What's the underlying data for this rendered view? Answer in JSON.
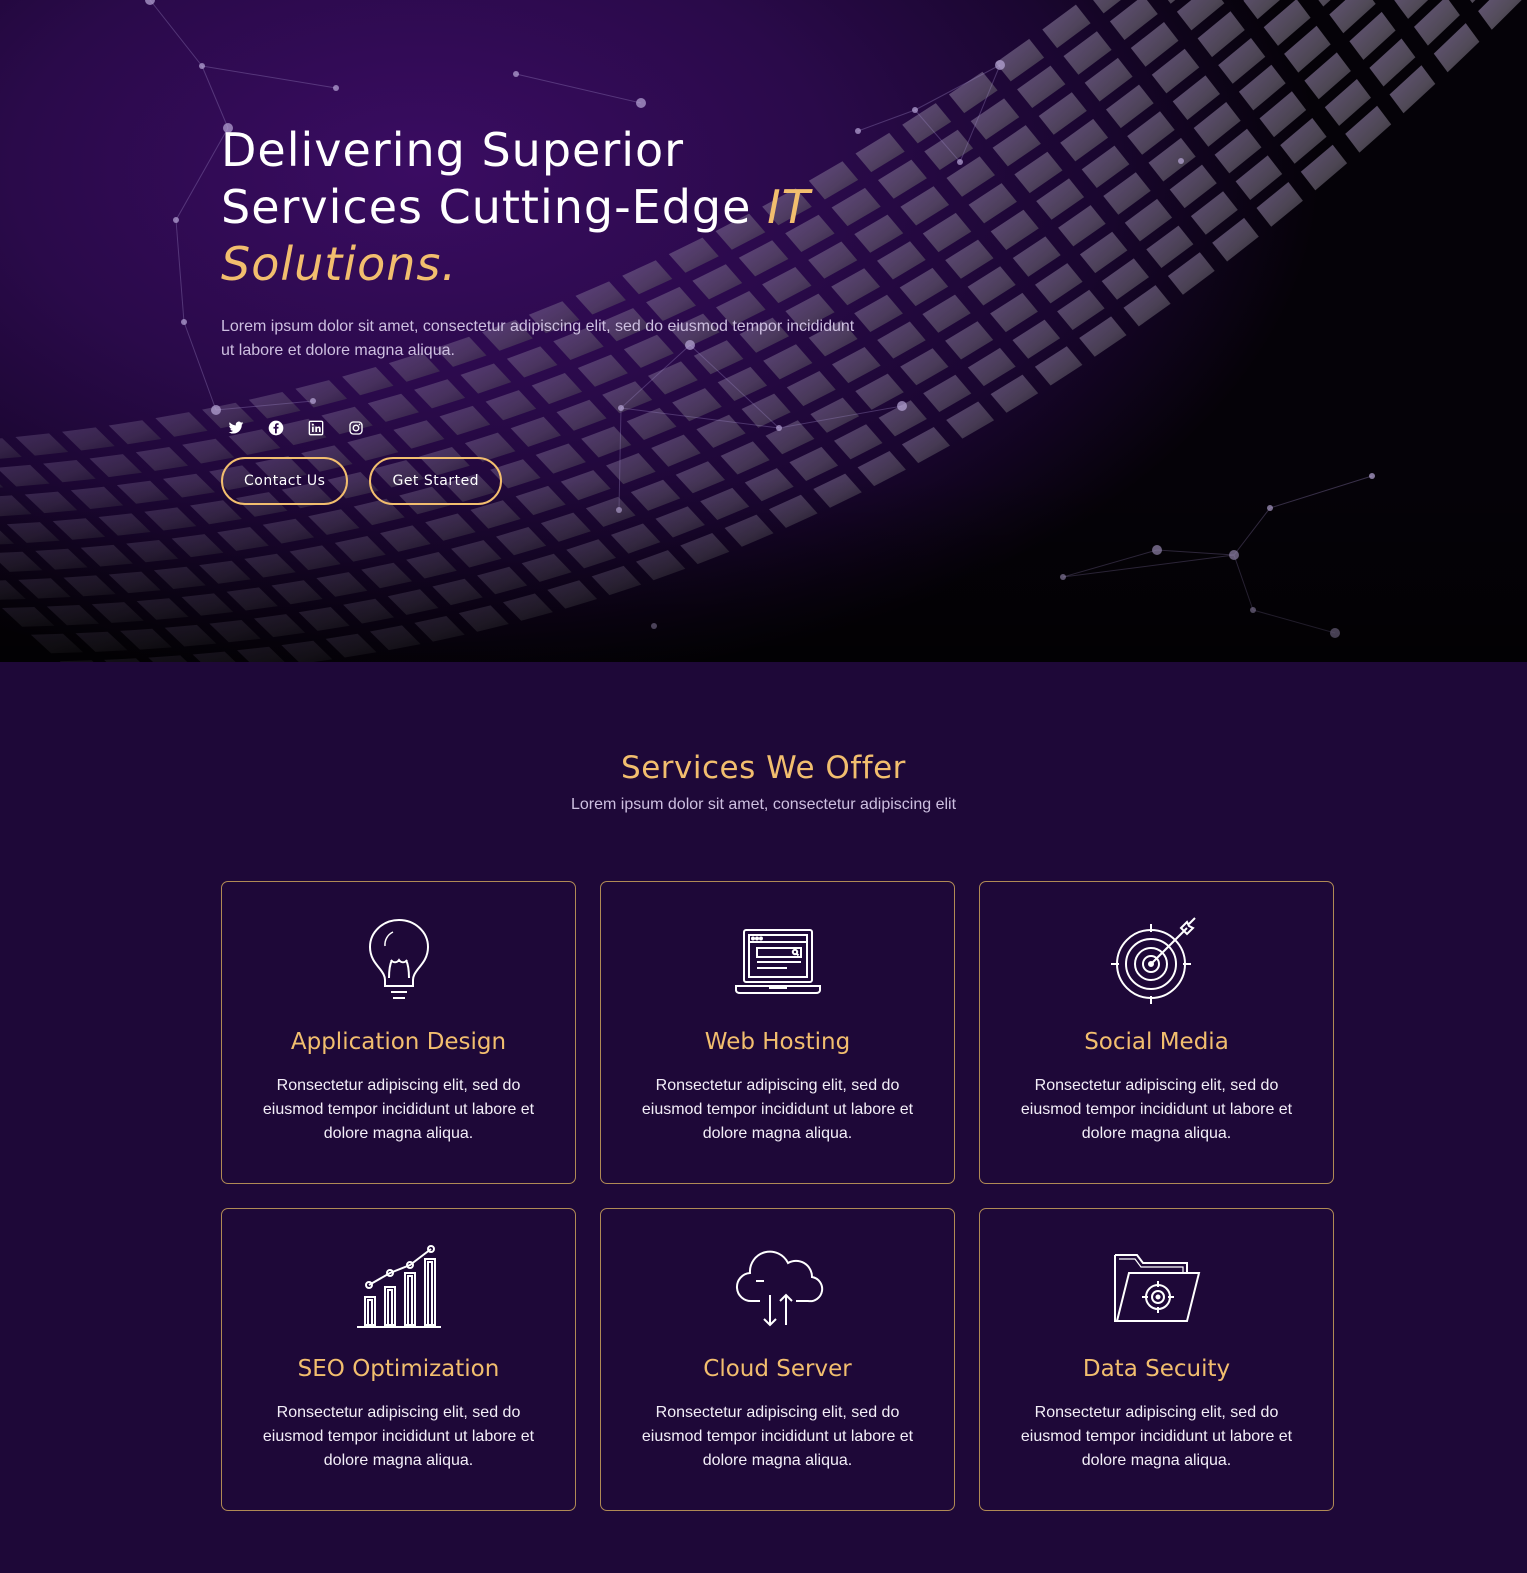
{
  "hero": {
    "title_line1": "Delivering Superior",
    "title_line2": "Services Cutting-Edge ",
    "title_accent1": "IT",
    "title_accent2": "Solutions.",
    "subtitle": "Lorem ipsum dolor sit amet, consectetur adipiscing elit, sed do eiusmod tempor incididunt ut labore et dolore magna aliqua.",
    "socials": [
      "twitter-icon",
      "facebook-icon",
      "linkedin-icon",
      "instagram-icon"
    ],
    "buttons": {
      "contact": "Contact Us",
      "start": "Get Started"
    }
  },
  "services": {
    "title": "Services We Offer",
    "subtitle": "Lorem ipsum dolor sit amet, consectetur adipiscing elit",
    "items": [
      {
        "icon": "lightbulb-icon",
        "title": "Application Design",
        "text": "Ronsectetur adipiscing elit, sed do eiusmod tempor incididunt ut labore et dolore magna aliqua."
      },
      {
        "icon": "laptop-icon",
        "title": "Web Hosting",
        "text": "Ronsectetur adipiscing elit, sed do eiusmod tempor incididunt ut labore et dolore magna aliqua."
      },
      {
        "icon": "target-icon",
        "title": "Social Media",
        "text": "Ronsectetur adipiscing elit, sed do eiusmod tempor incididunt ut labore et dolore magna aliqua."
      },
      {
        "icon": "bar-chart-icon",
        "title": "SEO Optimization",
        "text": "Ronsectetur adipiscing elit, sed do eiusmod tempor incididunt ut labore et dolore magna aliqua."
      },
      {
        "icon": "cloud-icon",
        "title": "Cloud Server",
        "text": "Ronsectetur adipiscing elit, sed do eiusmod tempor incididunt ut labore et dolore magna aliqua."
      },
      {
        "icon": "secure-folder-icon",
        "title": "Data Secuity",
        "text": "Ronsectetur adipiscing elit, sed do eiusmod tempor incididunt ut labore et dolore magna aliqua."
      }
    ]
  },
  "colors": {
    "accent": "#f2be6e",
    "background": "#1e0838",
    "hero": "#2a0a4a"
  }
}
